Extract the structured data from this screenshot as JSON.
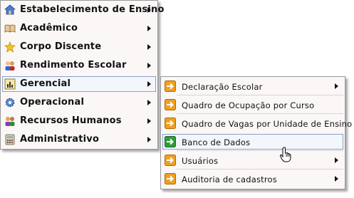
{
  "main_menu": {
    "items": [
      {
        "label": "Estabelecimento de Ensino",
        "icon": "house-icon"
      },
      {
        "label": "Acadêmico",
        "icon": "open-book-icon"
      },
      {
        "label": "Corpo Discente",
        "icon": "star-icon"
      },
      {
        "label": "Rendimento Escolar",
        "icon": "people-icon"
      },
      {
        "label": "Gerencial",
        "icon": "chart-icon"
      },
      {
        "label": "Operacional",
        "icon": "gear-icon"
      },
      {
        "label": "Recursos Humanos",
        "icon": "staff-icon"
      },
      {
        "label": "Administrativo",
        "icon": "calculator-icon"
      }
    ]
  },
  "sub_menu": {
    "items": [
      {
        "label": "Declaração Escolar",
        "icon": "orange-arrow-icon",
        "has_submenu": true
      },
      {
        "label": "Quadro de Ocupação por Curso",
        "icon": "orange-arrow-icon",
        "has_submenu": false
      },
      {
        "label": "Quadro de Vagas por Unidade de Ensino",
        "icon": "orange-arrow-icon",
        "has_submenu": false
      },
      {
        "label": "Banco de Dados",
        "icon": "green-arrow-icon",
        "has_submenu": false
      },
      {
        "label": "Usuários",
        "icon": "orange-arrow-icon",
        "has_submenu": true
      },
      {
        "label": "Auditoria de cadastros",
        "icon": "orange-arrow-icon",
        "has_submenu": true
      }
    ]
  },
  "colors": {
    "accent_orange": "#f0a020",
    "accent_green": "#2f9e3a",
    "highlight_border": "#8aa0c8"
  }
}
